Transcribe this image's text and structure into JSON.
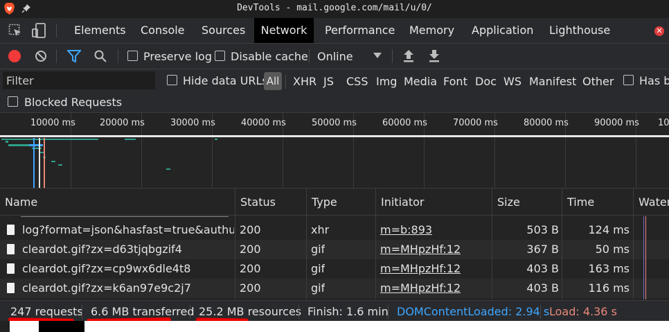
{
  "window": {
    "title": "DevTools - mail.google.com/mail/u/0/"
  },
  "tabs": [
    "Elements",
    "Console",
    "Sources",
    "Network",
    "Performance",
    "Memory",
    "Application",
    "Lighthouse"
  ],
  "active_tab": "Network",
  "toolbar": {
    "preserve_log": "Preserve log",
    "disable_cache": "Disable cache",
    "throttle_value": "Online"
  },
  "filter": {
    "placeholder": "Filter",
    "hide_data_urls": "Hide data URLs",
    "all": "All",
    "types": [
      "XHR",
      "JS",
      "CSS",
      "Img",
      "Media",
      "Font",
      "Doc",
      "WS",
      "Manifest",
      "Other"
    ],
    "has_blocked": "Has bl",
    "blocked_requests": "Blocked Requests"
  },
  "overview": {
    "ticks": [
      "10000 ms",
      "20000 ms",
      "30000 ms",
      "40000 ms",
      "50000 ms",
      "60000 ms",
      "70000 ms",
      "80000 ms",
      "90000 ms",
      "10"
    ]
  },
  "table": {
    "columns": [
      "Name",
      "Status",
      "Type",
      "Initiator",
      "Size",
      "Time",
      "Waterfall"
    ],
    "rows": [
      {
        "name": "log?format=json&hasfast=true&authuser...",
        "status": "200",
        "type": "xhr",
        "initiator": "m=b:893",
        "size": "503 B",
        "time": "124 ms"
      },
      {
        "name": "cleardot.gif?zx=d63tjqbgzif4",
        "status": "200",
        "type": "gif",
        "initiator": "m=MHpzHf:12",
        "size": "367 B",
        "time": "50 ms"
      },
      {
        "name": "cleardot.gif?zx=cp9wx6dle4t8",
        "status": "200",
        "type": "gif",
        "initiator": "m=MHpzHf:12",
        "size": "403 B",
        "time": "163 ms"
      },
      {
        "name": "cleardot.gif?zx=k6an97e9c2j7",
        "status": "200",
        "type": "gif",
        "initiator": "m=MHpzHf:12",
        "size": "403 B",
        "time": "116 ms"
      }
    ]
  },
  "status": {
    "requests": "247 requests",
    "transferred": "6.6 MB transferred",
    "resources": "25.2 MB resources",
    "finish": "Finish: 1.6 min",
    "dcl": "DOMContentLoaded: 2.94 s",
    "load": "Load: 4.36 s"
  },
  "colors": {
    "dcl": "#3ea6ff",
    "load": "#e8887a",
    "annotation": "#ee0000",
    "accent": "#1a73e8"
  }
}
